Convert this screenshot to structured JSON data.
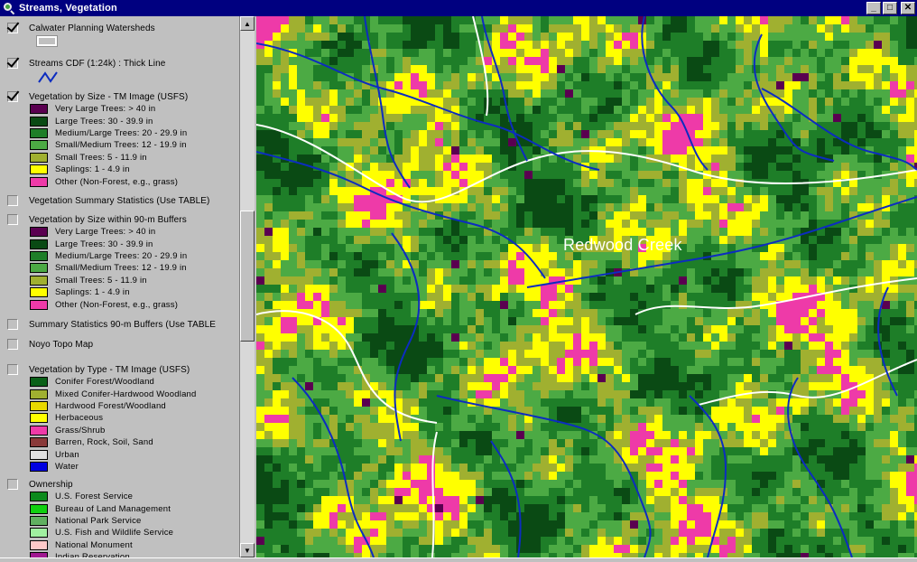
{
  "window": {
    "title": "Streams, Vegetation",
    "minimize_glyph": "_",
    "maximize_glyph": "□",
    "close_glyph": "✕"
  },
  "legend": {
    "layers": [
      {
        "id": "watersheds",
        "title": "Calwater Planning Watersheds",
        "checked": true,
        "symbol": "polygon",
        "items": []
      },
      {
        "id": "streams",
        "title": "Streams CDF (1:24k) : Thick Line",
        "checked": true,
        "symbol": "line",
        "items": []
      },
      {
        "id": "veg-size",
        "title": "Vegetation by Size - TM Image (USFS)",
        "checked": true,
        "items": [
          {
            "label": "Very Large Trees: > 40  in",
            "color": "#5a0050"
          },
          {
            "label": "Large Trees: 30 - 39.9 in",
            "color": "#0a4a14"
          },
          {
            "label": "Medium/Large Trees: 20 - 29.9 in",
            "color": "#1e7e28"
          },
          {
            "label": "Small/Medium Trees: 12 - 19.9 in",
            "color": "#4caa44"
          },
          {
            "label": "Small Trees: 5 - 11.9 in",
            "color": "#a0b030"
          },
          {
            "label": "Saplings: 1 - 4.9 in",
            "color": "#ffff00"
          },
          {
            "label": "Other (Non-Forest, e.g., grass)",
            "color": "#ee3aa8"
          }
        ]
      },
      {
        "id": "veg-summary",
        "title": "Vegetation Summary Statistics (Use TABLE)",
        "checked": false,
        "items": []
      },
      {
        "id": "veg-buffers",
        "title": "Vegetation by Size within 90-m Buffers",
        "checked": false,
        "items": [
          {
            "label": "Very Large Trees: > 40  in",
            "color": "#5a0050"
          },
          {
            "label": "Large Trees: 30 - 39.9 in",
            "color": "#0a4a14"
          },
          {
            "label": "Medium/Large Trees: 20 - 29.9 in",
            "color": "#1e7e28"
          },
          {
            "label": "Small/Medium Trees: 12 - 19.9 in",
            "color": "#4caa44"
          },
          {
            "label": "Small Trees: 5 - 11.9 in",
            "color": "#a0b030"
          },
          {
            "label": "Saplings: 1 - 4.9 in",
            "color": "#ffff00"
          },
          {
            "label": "Other (Non-Forest, e.g., grass)",
            "color": "#ee3aa8"
          }
        ]
      },
      {
        "id": "summary-buffers",
        "title": "Summary Statistics 90-m Buffers (Use TABLE",
        "checked": false,
        "items": []
      },
      {
        "id": "noyo-topo",
        "title": "Noyo Topo Map",
        "checked": false,
        "items": []
      },
      {
        "id": "veg-type",
        "title": "Vegetation by Type - TM Image (USFS)",
        "checked": false,
        "items": [
          {
            "label": "Conifer Forest/Woodland",
            "color": "#0a6018"
          },
          {
            "label": "Mixed Conifer-Hardwood Woodland",
            "color": "#a0b030"
          },
          {
            "label": "Hardwood Forest/Woodland",
            "color": "#e8d800"
          },
          {
            "label": "Herbaceous",
            "color": "#ffff00"
          },
          {
            "label": "Grass/Shrub",
            "color": "#ee3aa8"
          },
          {
            "label": "Barren, Rock, Soil, Sand",
            "color": "#8a3a3a"
          },
          {
            "label": "Urban",
            "color": "#e0e0e0"
          },
          {
            "label": "Water",
            "color": "#0000e0"
          }
        ]
      },
      {
        "id": "ownership",
        "title": "Ownership",
        "checked": false,
        "items": [
          {
            "label": "U.S. Forest Service",
            "color": "#0c8a1c"
          },
          {
            "label": "Bureau of Land Management",
            "color": "#10d010"
          },
          {
            "label": "National Park Service",
            "color": "#60b060"
          },
          {
            "label": "U.S. Fish and Wildlife Service",
            "color": "#a0f0a0"
          },
          {
            "label": "National Monument",
            "color": "#ffc8c8"
          },
          {
            "label": "Indian Reservation",
            "color": "#a01890"
          }
        ]
      }
    ]
  },
  "map": {
    "label": "Redwood Creek",
    "colors": {
      "very_large": "#5a0050",
      "large": "#0a4a14",
      "medium_large": "#1e7e28",
      "small_medium": "#4caa44",
      "small": "#a0b030",
      "saplings": "#ffff00",
      "other": "#ee3aa8",
      "stream": "#0c2cc0",
      "watershed": "#ffffff"
    }
  },
  "scrollbar": {
    "up_glyph": "▲",
    "down_glyph": "▼"
  }
}
